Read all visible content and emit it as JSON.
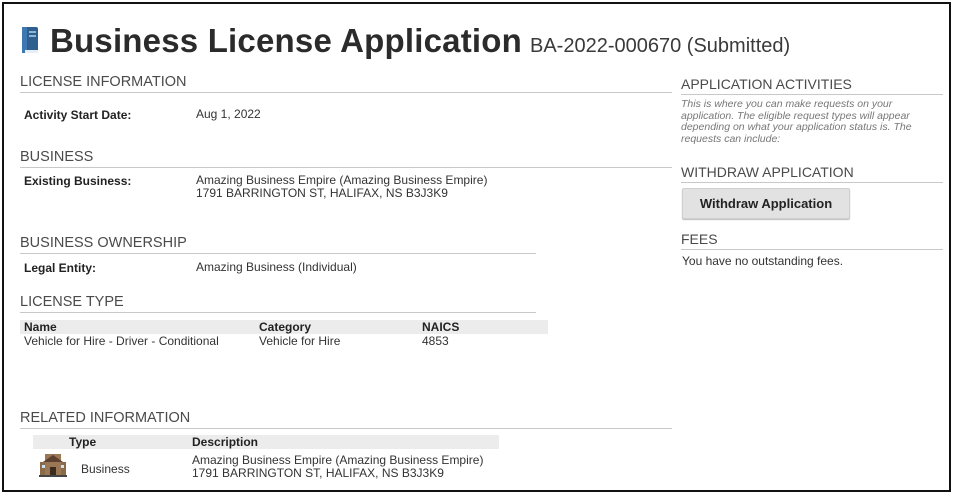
{
  "header": {
    "title": "Business License Application",
    "subtitle": "BA-2022-000670 (Submitted)",
    "icon": "book-icon"
  },
  "license_info": {
    "section_title": "LICENSE INFORMATION",
    "activity_start_label": "Activity Start Date:",
    "activity_start_value": "Aug 1, 2022"
  },
  "business": {
    "section_title": "BUSINESS",
    "existing_label": "Existing Business:",
    "existing_name": "Amazing Business Empire (Amazing Business Empire)",
    "existing_address": "1791 BARRINGTON ST, HALIFAX, NS B3J3K9"
  },
  "ownership": {
    "section_title": "BUSINESS OWNERSHIP",
    "legal_entity_label": "Legal Entity:",
    "legal_entity_value": "Amazing Business (Individual)"
  },
  "license_type": {
    "section_title": "LICENSE TYPE",
    "columns": [
      "Name",
      "Category",
      "NAICS"
    ],
    "rows": [
      [
        "Vehicle for Hire - Driver - Conditional",
        "Vehicle for Hire",
        "4853"
      ]
    ]
  },
  "related": {
    "section_title": "RELATED INFORMATION",
    "columns": [
      "Type",
      "Description"
    ],
    "rows": [
      {
        "icon": "building-icon",
        "type": "Business",
        "description_line1": "Amazing Business Empire (Amazing Business Empire)",
        "description_line2": "1791 BARRINGTON ST, HALIFAX, NS B3J3K9"
      }
    ]
  },
  "activities": {
    "section_title": "APPLICATION ACTIVITIES",
    "note": "This is where you can make requests on your application. The eligible request types will appear depending on what your application status is. The requests can include:",
    "withdraw_title": "WITHDRAW APPLICATION",
    "withdraw_button": "Withdraw Application",
    "fees_title": "FEES",
    "fees_text": "You have no outstanding fees."
  }
}
